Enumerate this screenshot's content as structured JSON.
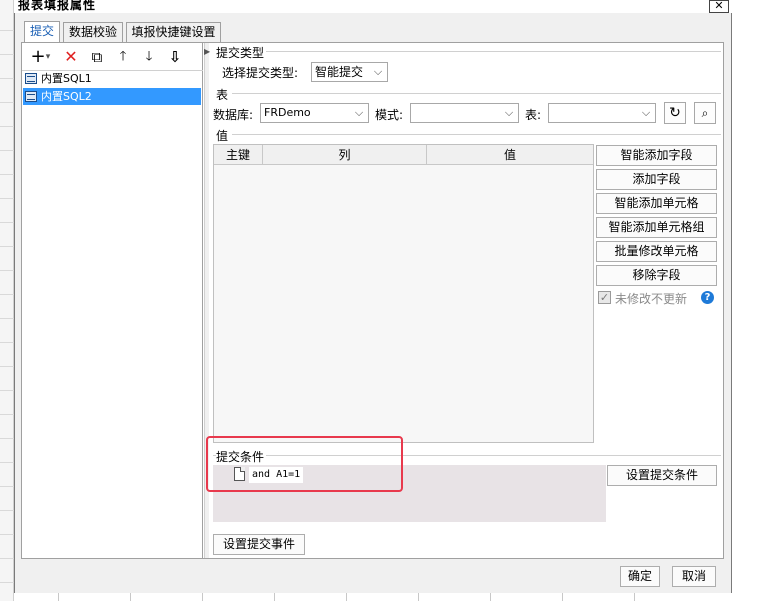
{
  "window": {
    "title": "报表填报属性",
    "close_glyph": "✕"
  },
  "tabs": [
    {
      "label": "提交",
      "active": true
    },
    {
      "label": "数据校验",
      "active": false
    },
    {
      "label": "填报快捷键设置",
      "active": false
    }
  ],
  "toolbar": {
    "add": "+",
    "add_dropdown": "▾",
    "delete": "✕",
    "copy": "⧉",
    "move_up": "🡑",
    "move_down": "🡓",
    "sort": "⇩"
  },
  "submit_list": [
    {
      "label": "内置SQL1",
      "selected": false
    },
    {
      "label": "内置SQL2",
      "selected": true
    }
  ],
  "submit_type": {
    "section_label": "提交类型",
    "field_label": "选择提交类型:",
    "value": "智能提交"
  },
  "table_section": {
    "section_label": "表",
    "database_label": "数据库:",
    "database_value": "FRDemo",
    "schema_label": "模式:",
    "schema_value": "",
    "table_label": "表:",
    "table_value": ""
  },
  "value_section": {
    "section_label": "值",
    "columns": [
      "主键",
      "列",
      "值"
    ],
    "rows": []
  },
  "value_buttons": [
    "智能添加字段",
    "添加字段",
    "智能添加单元格",
    "智能添加单元格组",
    "批量修改单元格",
    "移除字段"
  ],
  "unmodified_checkbox": {
    "label": "未修改不更新",
    "checked": true,
    "help": "?"
  },
  "condition_section": {
    "section_label": "提交条件",
    "item": "and A1=1",
    "set_button": "设置提交条件"
  },
  "event_button": "设置提交事件",
  "footer": {
    "ok": "确定",
    "cancel": "取消"
  },
  "colors": {
    "selection": "#3399ff",
    "highlight_box": "#e8394d",
    "delete_icon": "#e02020",
    "help_icon": "#1e7ad8"
  }
}
